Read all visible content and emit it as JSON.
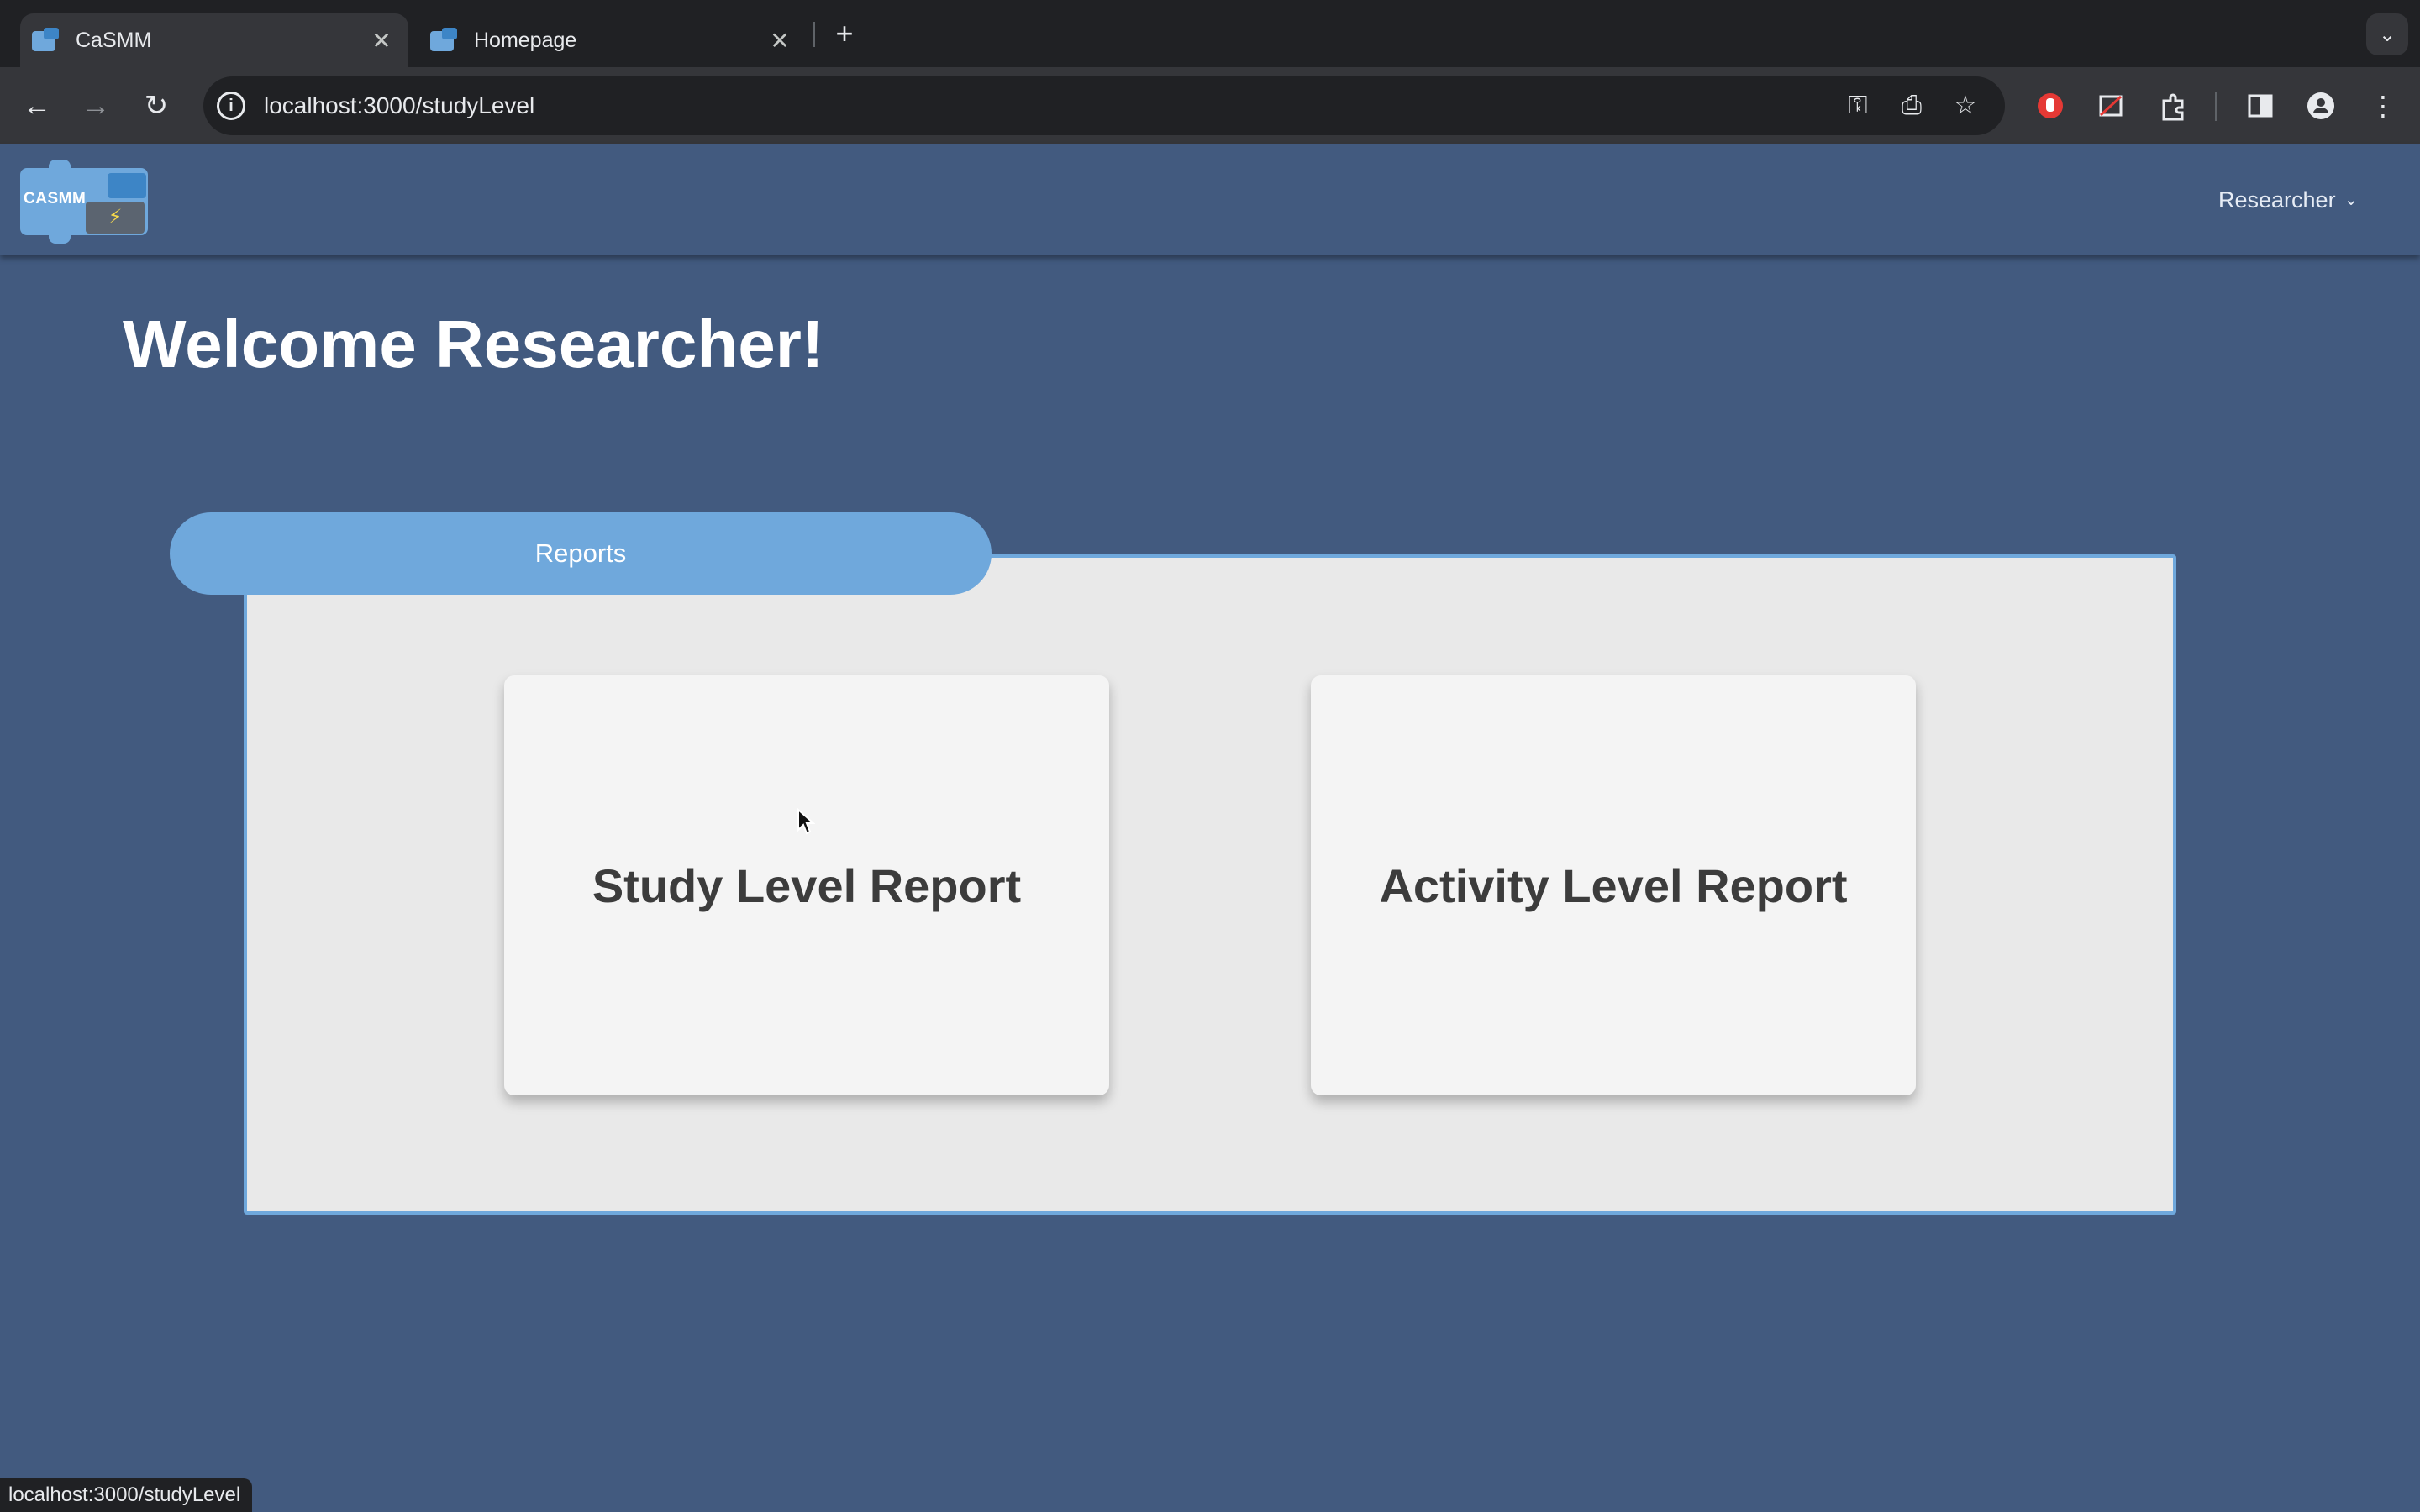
{
  "browser": {
    "tabs": [
      {
        "title": "CaSMM",
        "active": true
      },
      {
        "title": "Homepage",
        "active": false
      }
    ],
    "new_tab_symbol": "+",
    "close_symbol": "✕",
    "address": "localhost:3000/studyLevel",
    "status_url": "localhost:3000/studyLevel",
    "icons": [
      "back-icon",
      "forward-icon",
      "reload-icon",
      "site-info-icon",
      "password-key-icon",
      "install-app-icon",
      "bookmark-star-icon",
      "extension-adblock-icon",
      "extension-icon-2",
      "extensions-puzzle-icon",
      "side-panel-icon",
      "profile-icon",
      "menu-kebab-icon"
    ]
  },
  "app": {
    "logo_text": "CASMM",
    "role_menu_label": "Researcher",
    "welcome_heading": "Welcome Researcher!",
    "reports_tab_label": "Reports",
    "cards": {
      "study_label": "Study Level Report",
      "activity_label": "Activity Level Report"
    }
  },
  "colors": {
    "page_background": "#425a7f",
    "accent_blue": "#6fa8dc",
    "panel_background": "#e9e9e9",
    "card_background": "#f4f4f4"
  }
}
